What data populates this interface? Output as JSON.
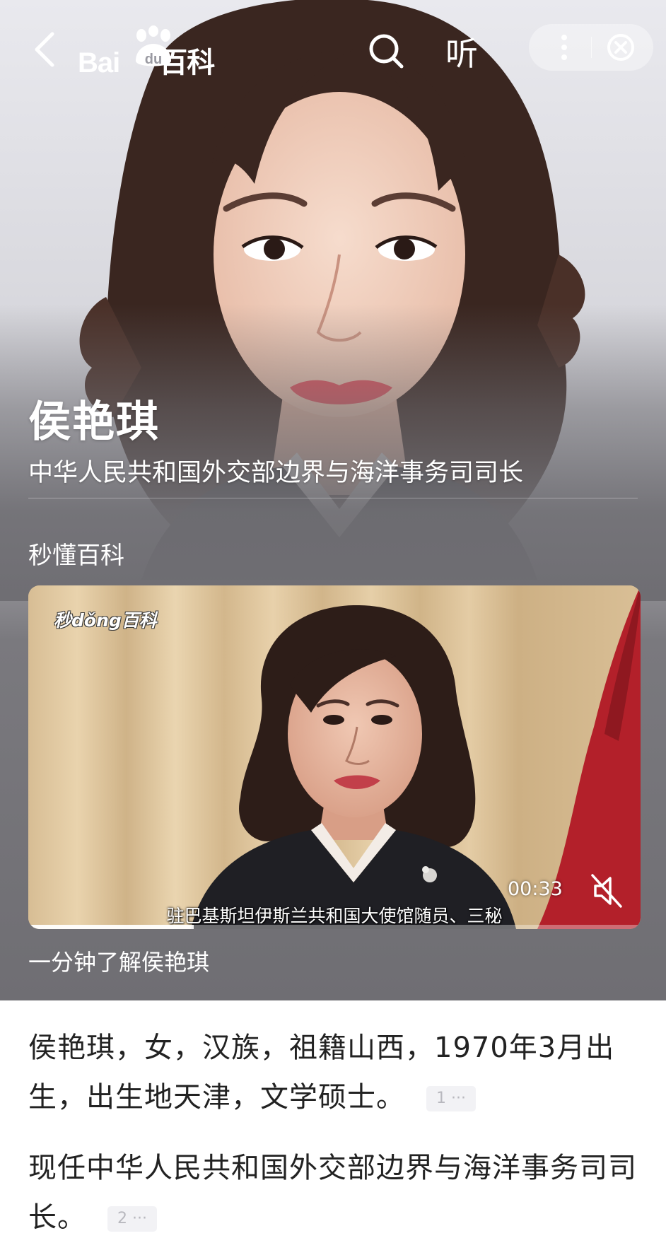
{
  "topbar": {
    "logo_text": "Bai",
    "logo_sub": "百科",
    "listen_label": "听"
  },
  "hero": {
    "name": "侯艳琪",
    "subtitle": "中华人民共和国外交部边界与海洋事务司司长",
    "section_label": "秒懂百科"
  },
  "video": {
    "watermark": "秒dǒng百科",
    "caption": "驻巴基斯坦伊斯兰共和国大使馆随员、三秘",
    "time": "00:33",
    "title": "一分钟了解侯艳琪",
    "progress": 0.27
  },
  "content": {
    "paragraph1": "侯艳琪，女，汉族，祖籍山西，1970年3月出生，出生地天津，文学硕士。",
    "ref1": "1 ···",
    "paragraph2": "现任中华人民共和国外交部边界与海洋事务司司长。",
    "ref2": "2 ···"
  },
  "colors": {
    "hero_gray": "#6f6e73",
    "text_dark": "#222222",
    "ref_bg": "#f2f2f5",
    "ref_text": "#b8b8be"
  }
}
